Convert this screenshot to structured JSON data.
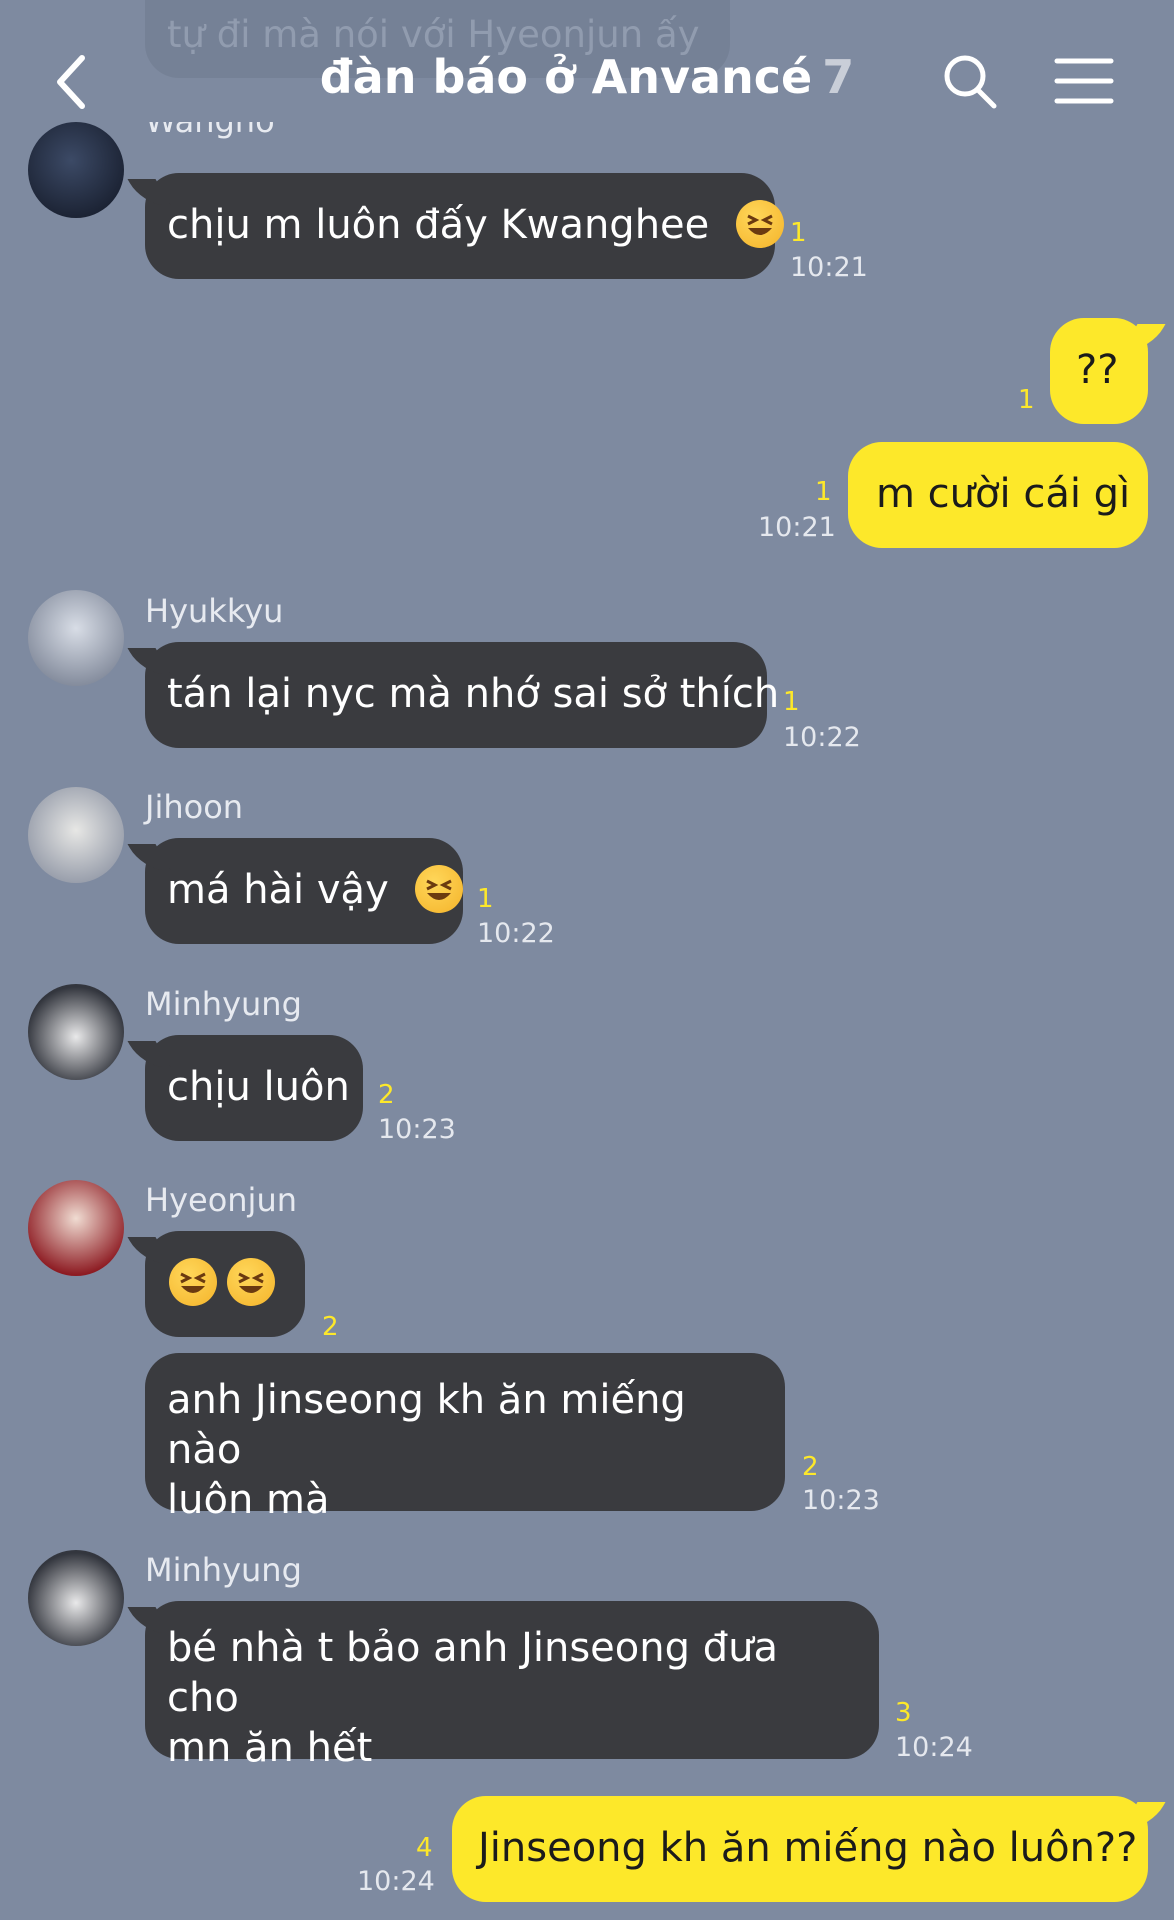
{
  "header": {
    "prev_message": "tự đi mà nói với Hyeonjun ấy",
    "title": "đàn báo ở Anvancé",
    "member_count": "7"
  },
  "messages": [
    {
      "sender": "Wangho",
      "text": "chịu m luôn đấy Kwanghee",
      "emoji": "laughing-face",
      "unread": "1",
      "time": "10:21"
    },
    {
      "text": "??",
      "unread": "1"
    },
    {
      "text": "m cười cái gì",
      "unread": "1",
      "time": "10:21"
    },
    {
      "sender": "Hyukkyu",
      "text": "tán lại nyc mà nhớ sai sở thích",
      "unread": "1",
      "time": "10:22"
    },
    {
      "sender": "Jihoon",
      "text": "má hài vậy",
      "emoji": "laughing-face",
      "unread": "1",
      "time": "10:22"
    },
    {
      "sender": "Minhyung",
      "text": "chịu luôn",
      "unread": "2",
      "time": "10:23"
    },
    {
      "sender": "Hyeonjun",
      "emoji": "laughing-face x2",
      "unread": "2"
    },
    {
      "text_line1": "anh Jinseong kh ăn miếng nào",
      "text_line2": "luôn mà",
      "unread": "2",
      "time": "10:23"
    },
    {
      "sender": "Minhyung",
      "text_line1": "bé nhà t bảo anh Jinseong đưa cho",
      "text_line2": "mn ăn hết",
      "unread": "3",
      "time": "10:24"
    },
    {
      "text": "Jinseong kh ăn miếng nào luôn??",
      "unread": "4",
      "time": "10:24"
    }
  ],
  "colors": {
    "background": "#7e8aa0",
    "incoming_bubble": "#3a3b3f",
    "outgoing_bubble": "#fde82a",
    "unread_count": "#fde82a"
  }
}
